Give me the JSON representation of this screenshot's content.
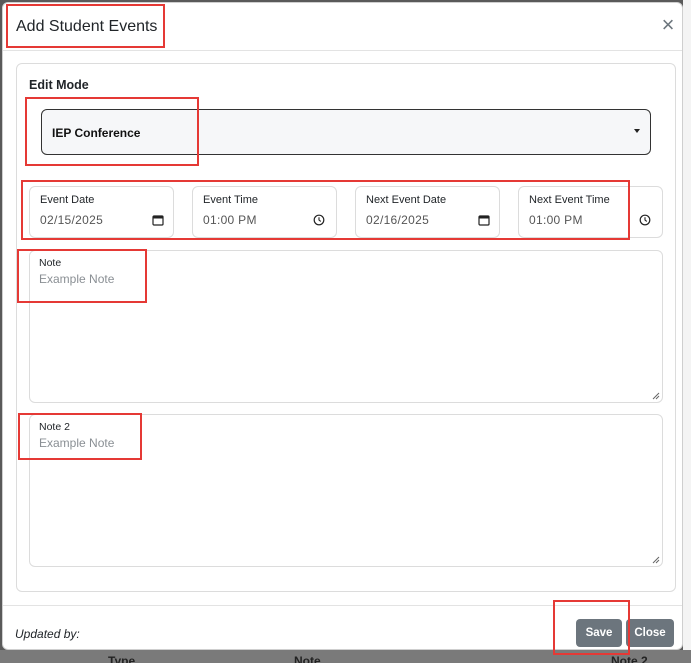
{
  "modal": {
    "title": "Add Student Events",
    "close_glyph": "×",
    "icons": {
      "close": "close-icon"
    }
  },
  "form": {
    "section_label": "Edit Mode",
    "edit_mode": {
      "selected": "IEP Conference",
      "icon": "chevron-down-icon"
    },
    "fields": [
      {
        "label": "Event Date",
        "value": "02/15/2025",
        "icon": "calendar-icon"
      },
      {
        "label": "Event Time",
        "value": "01:00 PM",
        "icon": "clock-icon"
      },
      {
        "label": "Next Event Date",
        "value": "02/16/2025",
        "icon": "calendar-icon"
      },
      {
        "label": "Next Event Time",
        "value": "01:00 PM",
        "icon": "clock-icon"
      }
    ],
    "note": {
      "label": "Note",
      "placeholder": "Example Note"
    },
    "note2": {
      "label": "Note 2",
      "placeholder": "Example Note"
    }
  },
  "footer": {
    "updated_by": "Updated by:",
    "save_label": "Save",
    "close_label": "Close"
  },
  "background": {
    "columns": [
      "Type",
      "Note",
      "Note 2"
    ]
  },
  "colors": {
    "highlight": "#e53935",
    "button": "#6c757d"
  }
}
